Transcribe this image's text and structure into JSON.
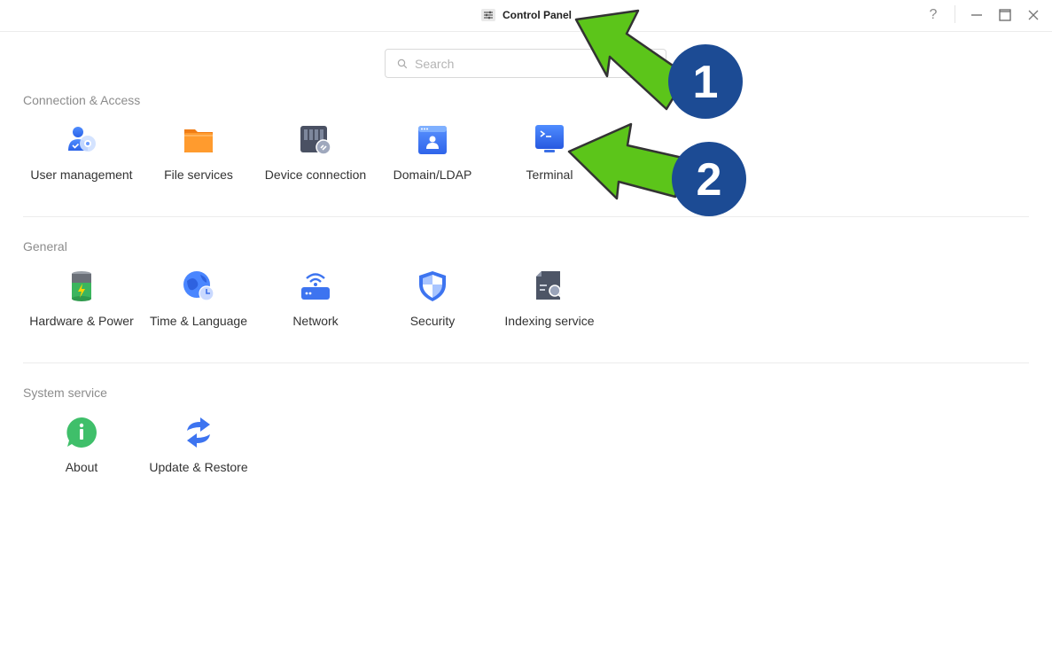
{
  "window": {
    "title": "Control Panel",
    "title_icon": "sliders-icon",
    "controls": {
      "help": "?",
      "minimize": "minimize-icon",
      "maximize": "maximize-icon",
      "close": "close-icon"
    }
  },
  "search": {
    "placeholder": "Search",
    "value": ""
  },
  "sections": [
    {
      "title": "Connection & Access",
      "items": [
        {
          "label": "User management",
          "icon": "user-management-icon"
        },
        {
          "label": "File services",
          "icon": "folder-icon"
        },
        {
          "label": "Device connection",
          "icon": "device-connection-icon"
        },
        {
          "label": "Domain/LDAP",
          "icon": "domain-ldap-icon"
        },
        {
          "label": "Terminal",
          "icon": "terminal-icon"
        }
      ]
    },
    {
      "title": "General",
      "items": [
        {
          "label": "Hardware & Power",
          "icon": "battery-icon"
        },
        {
          "label": "Time & Language",
          "icon": "globe-clock-icon"
        },
        {
          "label": "Network",
          "icon": "router-wifi-icon"
        },
        {
          "label": "Security",
          "icon": "shield-icon"
        },
        {
          "label": "Indexing service",
          "icon": "indexing-search-icon"
        }
      ]
    },
    {
      "title": "System service",
      "items": [
        {
          "label": "About",
          "icon": "info-icon"
        },
        {
          "label": "Update & Restore",
          "icon": "sync-arrows-icon"
        }
      ]
    }
  ],
  "annotations": [
    {
      "number": "1",
      "target": "window-title"
    },
    {
      "number": "2",
      "target": "tile-terminal"
    }
  ],
  "colors": {
    "arrow": "#5cc51a",
    "badge": "#1c4b94",
    "accent_blue": "#3d7bf5"
  }
}
